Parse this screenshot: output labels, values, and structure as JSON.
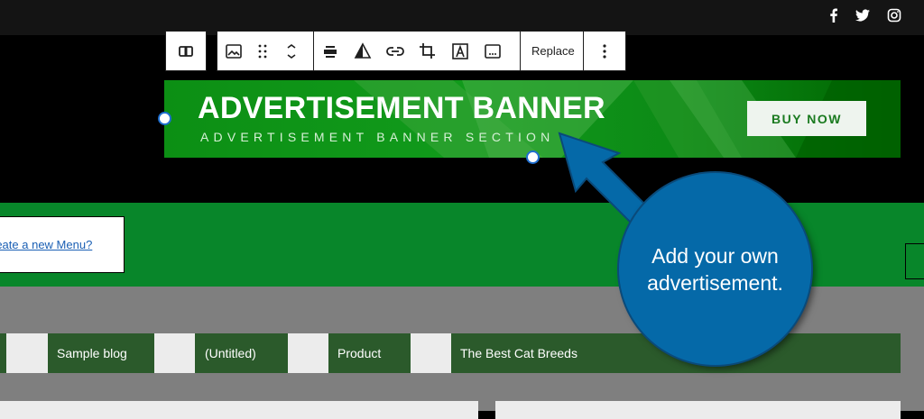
{
  "social": {
    "icons": [
      "facebook-icon",
      "twitter-icon",
      "instagram-icon"
    ]
  },
  "toolbar": {
    "icons": [
      "align-full-icon",
      "image-icon",
      "drag-handle-icon",
      "move-up-down-icon",
      "align-text-icon",
      "duotone-icon",
      "link-icon",
      "crop-icon",
      "text-overlay-icon",
      "alt-text-icon",
      "more-options-icon"
    ],
    "replace_label": "Replace"
  },
  "banner": {
    "title": "ADVERTISEMENT BANNER",
    "subtitle": "ADVERTISEMENT BANNER SECTION",
    "button_label": "BUY NOW",
    "colors": {
      "green": "#0c8f14",
      "dark_green": "#006400",
      "button_bg": "#eef4ee"
    }
  },
  "nav": {
    "menu_link": "reate a new Menu?"
  },
  "menu": {
    "items": [
      "Sample blog",
      "(Untitled)",
      "Product",
      "The Best Cat Breeds"
    ]
  },
  "callout": {
    "text": "Add your own advertisement.",
    "color": "#0569a8"
  }
}
